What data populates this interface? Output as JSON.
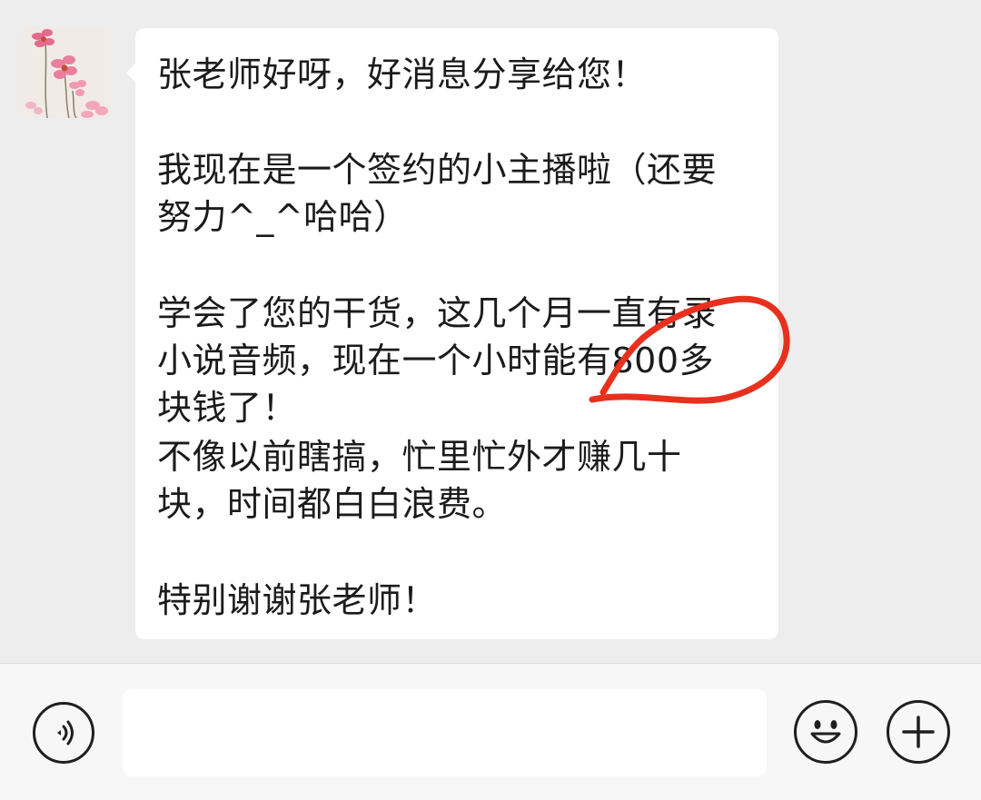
{
  "chat": {
    "message": {
      "lines": [
        "张老师好呀，好消息分享给您！",
        "我现在是一个签约的小主播啦（还要",
        "努力^_^哈哈）",
        "学会了您的干货，这几个月一直有录",
        "小说音频，现在一个小时能有800多",
        "块钱了！",
        "不像以前瞎搞，忙里忙外才赚几十",
        "块，时间都白白浪费。",
        "特别谢谢张老师！"
      ]
    },
    "annotation_color": "#e8301e"
  },
  "input_bar": {
    "voice_icon": "voice-icon",
    "input_value": "",
    "emoji_icon": "smiley-face-icon",
    "plus_icon": "plus-icon"
  }
}
